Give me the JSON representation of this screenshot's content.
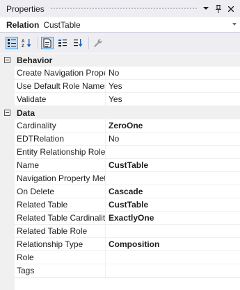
{
  "window": {
    "title": "Properties"
  },
  "selector": {
    "kind": "Relation",
    "object": "CustTable"
  },
  "toolbar": {
    "buttons": [
      {
        "icon": "categorized-icon",
        "active": true
      },
      {
        "icon": "alphabetical-icon",
        "active": false
      },
      {
        "icon": "properties-page-icon",
        "active": true
      },
      {
        "icon": "events-icon",
        "active": false
      },
      {
        "icon": "sort-icon",
        "active": false
      },
      {
        "icon": "property-pages-wrench-icon",
        "active": false
      }
    ]
  },
  "grid": {
    "categories": [
      {
        "label": "Behavior",
        "rows": [
          {
            "name": "Create Navigation Property Methods",
            "value": "No",
            "bold": false
          },
          {
            "name": "Use Default Role Names",
            "value": "Yes",
            "bold": false
          },
          {
            "name": "Validate",
            "value": "Yes",
            "bold": false
          }
        ]
      },
      {
        "label": "Data",
        "rows": [
          {
            "name": "Cardinality",
            "value": "ZeroOne",
            "bold": true
          },
          {
            "name": "EDTRelation",
            "value": "No",
            "bold": false
          },
          {
            "name": "Entity Relationship Role",
            "value": "",
            "bold": false
          },
          {
            "name": "Name",
            "value": "CustTable",
            "bold": true
          },
          {
            "name": "Navigation Property Methods",
            "value": "",
            "bold": false
          },
          {
            "name": "On Delete",
            "value": "Cascade",
            "bold": true
          },
          {
            "name": "Related Table",
            "value": "CustTable",
            "bold": true
          },
          {
            "name": "Related Table Cardinality",
            "value": "ExactlyOne",
            "bold": true
          },
          {
            "name": "Related Table Role",
            "value": "",
            "bold": false
          },
          {
            "name": "Relationship Type",
            "value": "Composition",
            "bold": true
          },
          {
            "name": "Role",
            "value": "",
            "bold": false
          },
          {
            "name": "Tags",
            "value": "",
            "bold": false
          }
        ]
      }
    ]
  }
}
